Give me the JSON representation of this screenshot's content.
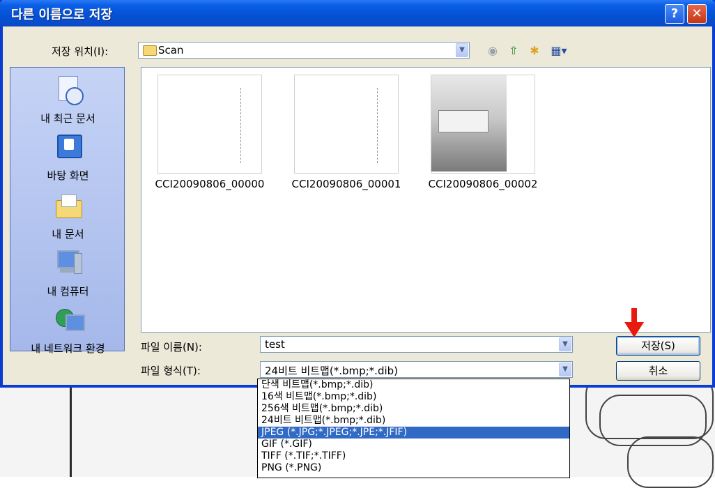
{
  "dialog": {
    "title": "다른 이름으로 저장",
    "help_icon": "help-icon",
    "close_icon": "close-icon"
  },
  "save_in": {
    "label": "저장 위치(I):",
    "value": "Scan"
  },
  "toolbar": [
    "back-icon",
    "up-folder-icon",
    "new-folder-icon",
    "view-menu-icon"
  ],
  "places": [
    {
      "label": "내 최근 문서",
      "icon": "recent-documents-icon"
    },
    {
      "label": "바탕 화면",
      "icon": "desktop-icon"
    },
    {
      "label": "내 문서",
      "icon": "my-documents-icon"
    },
    {
      "label": "내 컴퓨터",
      "icon": "my-computer-icon"
    },
    {
      "label": "내 네트워크 환경",
      "icon": "network-icon"
    }
  ],
  "files": [
    {
      "name": "CCI20090806_00000"
    },
    {
      "name": "CCI20090806_00001"
    },
    {
      "name": "CCI20090806_00002"
    }
  ],
  "filename": {
    "label": "파일 이름(N):",
    "value": "test"
  },
  "filetype": {
    "label": "파일 형식(T):",
    "value": "24비트 비트맵(*.bmp;*.dib)",
    "options": [
      "단색 비트맵(*.bmp;*.dib)",
      "16색 비트맵(*.bmp;*.dib)",
      "256색 비트맵(*.bmp;*.dib)",
      "24비트 비트맵(*.bmp;*.dib)",
      "JPEG (*.JPG;*.JPEG;*.JPE;*.JFIF)",
      "GIF (*.GIF)",
      "TIFF (*.TIF;*.TIFF)",
      "PNG (*.PNG)"
    ],
    "selected_option": "JPEG (*.JPG;*.JPEG;*.JPE;*.JFIF)"
  },
  "buttons": {
    "save": "저장(S)",
    "cancel": "취소"
  },
  "colors": {
    "title_blue": "#0451d4",
    "selection": "#316ac5",
    "arrow_red": "#e8190f"
  }
}
